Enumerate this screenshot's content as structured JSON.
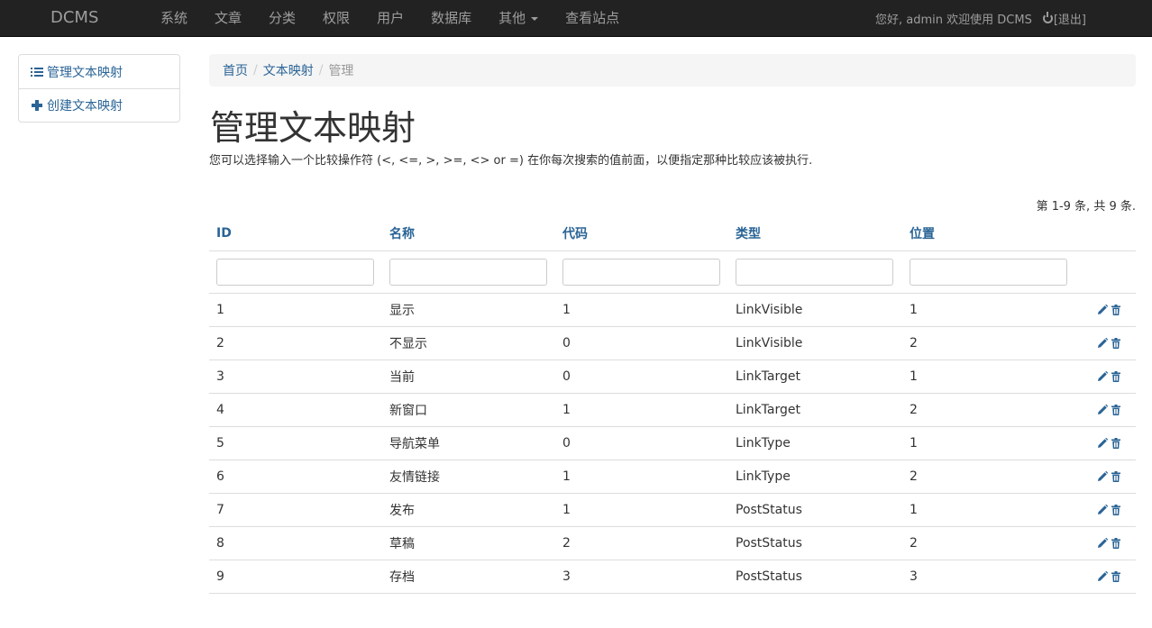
{
  "brand": "DCMS",
  "nav": {
    "items": [
      "系统",
      "文章",
      "分类",
      "权限",
      "用户",
      "数据库",
      "其他",
      "查看站点"
    ]
  },
  "user": {
    "greeting": "您好, admin 欢迎使用 DCMS",
    "logout": "[退出]"
  },
  "sidebar": {
    "items": [
      {
        "label": "管理文本映射",
        "icon": "list-icon"
      },
      {
        "label": "创建文本映射",
        "icon": "plus-icon"
      }
    ]
  },
  "breadcrumb": {
    "home": "首页",
    "section": "文本映射",
    "current": "管理"
  },
  "page": {
    "title": "管理文本映射",
    "hint": "您可以选择输入一个比较操作符 (<, <=, >, >=, <> or =) 在你每次搜索的值前面，以便指定那种比较应该被执行.",
    "summary": "第 1-9 条, 共 9 条."
  },
  "table": {
    "columns": [
      "ID",
      "名称",
      "代码",
      "类型",
      "位置"
    ],
    "rows": [
      [
        "1",
        "显示",
        "1",
        "LinkVisible",
        "1"
      ],
      [
        "2",
        "不显示",
        "0",
        "LinkVisible",
        "2"
      ],
      [
        "3",
        "当前",
        "0",
        "LinkTarget",
        "1"
      ],
      [
        "4",
        "新窗口",
        "1",
        "LinkTarget",
        "2"
      ],
      [
        "5",
        "导航菜单",
        "0",
        "LinkType",
        "1"
      ],
      [
        "6",
        "友情链接",
        "1",
        "LinkType",
        "2"
      ],
      [
        "7",
        "发布",
        "1",
        "PostStatus",
        "1"
      ],
      [
        "8",
        "草稿",
        "2",
        "PostStatus",
        "2"
      ],
      [
        "9",
        "存档",
        "3",
        "PostStatus",
        "3"
      ]
    ]
  },
  "colors": {
    "navbar": "#222222",
    "link": "#2a6496"
  }
}
